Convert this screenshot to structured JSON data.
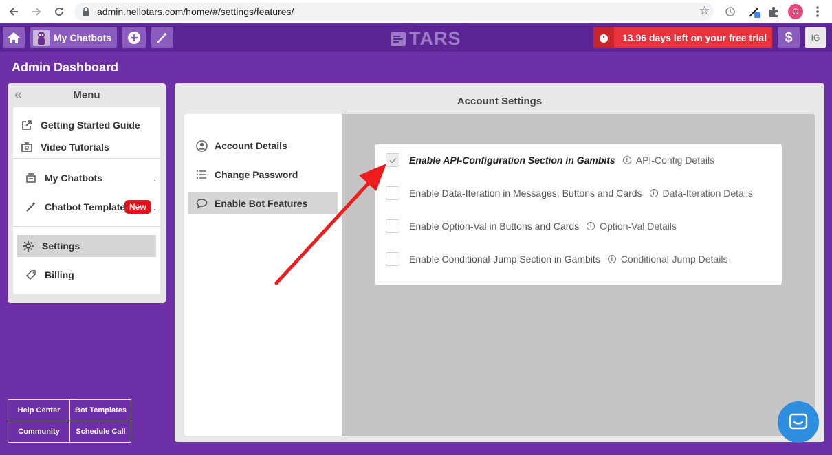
{
  "browser": {
    "url": "admin.hellotars.com/home/#/settings/features/",
    "profile_initial": "O"
  },
  "topbar": {
    "my_chatbots_label": "My Chatbots",
    "logo_text": "TARS",
    "trial_text": "13.96 days left on your free trial",
    "billing_symbol": "$",
    "user_initials": "IG"
  },
  "page_title": "Admin Dashboard",
  "sidebar": {
    "title": "Menu",
    "items": [
      {
        "label": "Getting Started Guide",
        "icon": "external-link-icon"
      },
      {
        "label": "Video Tutorials",
        "icon": "video-icon"
      },
      {
        "label": "My Chatbots",
        "icon": "chatbots-icon"
      },
      {
        "label": "Chatbot Templates",
        "icon": "magic-wand-icon",
        "badge": "New"
      },
      {
        "label": "Settings",
        "icon": "gear-icon",
        "active": true
      },
      {
        "label": "Billing",
        "icon": "tag-icon"
      }
    ],
    "dot": "."
  },
  "footer_links": [
    "Help Center",
    "Bot Templates",
    "Community",
    "Schedule Call"
  ],
  "main": {
    "title": "Account Settings",
    "sub_nav": [
      {
        "label": "Account Details",
        "icon": "user-circle-icon"
      },
      {
        "label": "Change Password",
        "icon": "list-icon"
      },
      {
        "label": "Enable Bot Features",
        "icon": "chat-bubble-icon",
        "active": true
      }
    ],
    "features": [
      {
        "label": "Enable API-Configuration Section in Gambits",
        "details": "API-Config Details",
        "checked": true
      },
      {
        "label": "Enable Data-Iteration in Messages, Buttons and Cards",
        "details": "Data-Iteration Details",
        "checked": false
      },
      {
        "label": "Enable Option-Val in Buttons and Cards",
        "details": "Option-Val Details",
        "checked": false
      },
      {
        "label": "Enable Conditional-Jump Section in Gambits",
        "details": "Conditional-Jump Details",
        "checked": false
      }
    ]
  },
  "colors": {
    "page_bg": "#6e30a8",
    "topbar_bg": "#5c2596",
    "trial_red": "#e8333d",
    "arrow_red": "#ee1c1c",
    "chat_blue": "#2d8ee0"
  }
}
